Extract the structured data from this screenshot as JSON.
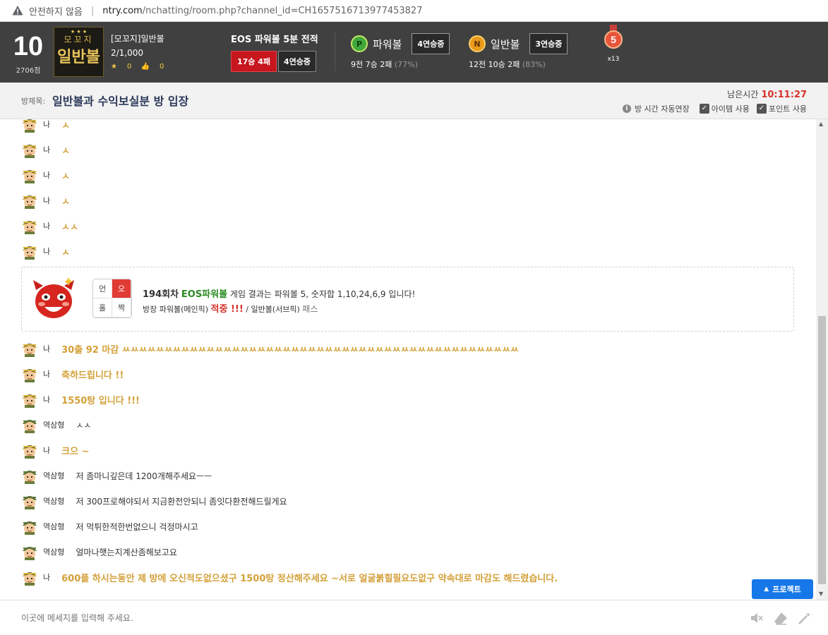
{
  "browser": {
    "security_label": "안전하지 않음",
    "url_host": "ntry.com",
    "url_path": "/nchatting/room.php?channel_id=CH1657516713977453827"
  },
  "header": {
    "level": "10",
    "points": "2706점",
    "room_logo_top": "모꼬지",
    "room_logo_main": "일반볼",
    "room_name": "[모꼬지]일반볼",
    "members": "2/1,000",
    "stars": "0",
    "likes": "0",
    "eos_title": "EOS 파워볼 5분 전적",
    "eos_record": "17승 4패",
    "eos_streak": "4연승중",
    "powerball": {
      "icon": "P",
      "label": "파워볼",
      "streak": "4연승중",
      "record": "9전 7승 2패",
      "pct": "(77%)"
    },
    "normalball": {
      "icon": "N",
      "label": "일반볼",
      "streak": "3연승중",
      "record": "12전 10승 2패",
      "pct": "(83%)"
    },
    "medal_number": "5",
    "medal_count": "x13"
  },
  "room": {
    "title_label": "방제목:",
    "title": "일반볼과 수익보실분 방 입장",
    "remaining_label": "남은시간",
    "remaining_time": "10:11:27",
    "auto_extend": "방 시간 자동연장",
    "item_use": "아이템 사용",
    "point_use": "포인트 사용"
  },
  "messages_top": [
    {
      "nick": "나",
      "text": "ㅅ"
    },
    {
      "nick": "나",
      "text": "ㅅ"
    },
    {
      "nick": "나",
      "text": "ㅅ"
    },
    {
      "nick": "나",
      "text": "ㅅ"
    },
    {
      "nick": "나",
      "text": "ㅅㅅ"
    },
    {
      "nick": "나",
      "text": "ㅅ"
    }
  ],
  "result": {
    "grid": [
      "언",
      "오",
      "홀",
      "짝"
    ],
    "round": "194회차",
    "game": "EOS파워볼",
    "desc": "게임 결과는 파워볼 5, 숫자합 1,10,24,6,9 입니다!",
    "line2_a": "방장 파워볼(메인픽)",
    "hit": "적중 !!!",
    "line2_b": "/ 일반볼(서브픽)",
    "pass": "패스"
  },
  "messages_bottom": [
    {
      "nick": "나",
      "text": "30출 92 마감 ㅆㅆㅆㅆㅆㅆㅆㅆㅆㅆㅆㅆㅆㅆㅆㅆㅆㅆㅆㅆㅆㅆㅆㅆㅆㅆㅆㅆㅆㅆㅆㅆㅆㅆㅆㅆㅆㅆㅆㅆㅆㅆㅆㅆㅆㅆㅆ",
      "mine": true
    },
    {
      "nick": "나",
      "text": "축하드립니다 !!",
      "mine": true
    },
    {
      "nick": "나",
      "text": "1550탕 입니다 !!!",
      "mine": true
    },
    {
      "nick": "역삼형",
      "text": "ㅅㅅ",
      "mine": false
    },
    {
      "nick": "나",
      "text": "크으 ~",
      "mine": true
    },
    {
      "nick": "역삼형",
      "text": "저 좀마니깊은데 1200개해주세요ㅡㅡ",
      "mine": false
    },
    {
      "nick": "역삼형",
      "text": "저 300프로해야되서 지금환전안되니 좀잇다환전해드릴게요",
      "mine": false
    },
    {
      "nick": "역삼형",
      "text": "저 먹튀한적한번없으니 걱정마시고",
      "mine": false
    },
    {
      "nick": "역삼형",
      "text": "얼마나햇는지계산좀해보고요",
      "mine": false
    },
    {
      "nick": "나",
      "text": "600플 하시는동안 제 방에 오신적도없으셨구 1500탕 정산해주세요 ~서로 얼굴붉힐필요도없구 약속대로 마감도 해드렸습니다.",
      "mine": true
    }
  ],
  "project_button": "프로젝트",
  "input": {
    "placeholder": "이곳에 메세지를 입력해 주세요."
  }
}
